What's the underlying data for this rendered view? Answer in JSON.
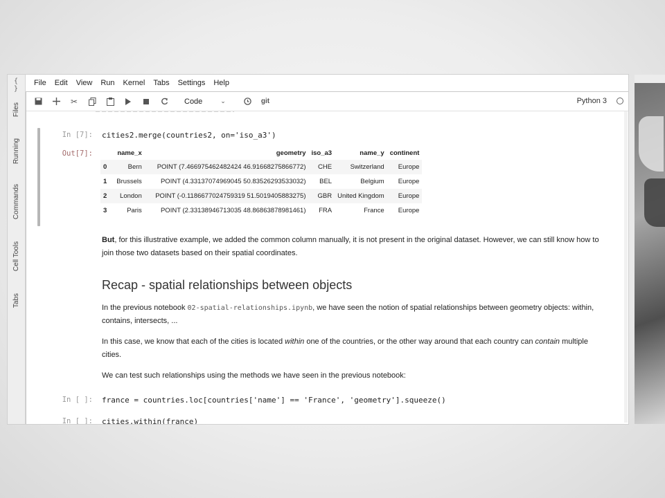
{
  "sidebar": {
    "top_mark": "{ }",
    "tabs": [
      "Files",
      "Running",
      "Commands",
      "Cell Tools",
      "Tabs"
    ]
  },
  "menubar": [
    "File",
    "Edit",
    "View",
    "Run",
    "Kernel",
    "Tabs",
    "Settings",
    "Help"
  ],
  "toolbar": {
    "icons": [
      "save-icon",
      "add-icon",
      "cut-icon",
      "copy-icon",
      "paste-icon",
      "run-icon",
      "stop-icon",
      "restart-icon"
    ],
    "cell_type": "Code",
    "git_label": "git",
    "kernel_name": "Python 3"
  },
  "cells": {
    "merge": {
      "in_prompt": "In [7]:",
      "code": "cities2.merge(countries2, on='iso_a3')",
      "out_prompt": "Out[7]:",
      "table": {
        "columns": [
          "",
          "name_x",
          "geometry",
          "iso_a3",
          "name_y",
          "continent"
        ],
        "rows": [
          [
            "0",
            "Bern",
            "POINT (7.466975462482424 46.91668275866772)",
            "CHE",
            "Switzerland",
            "Europe"
          ],
          [
            "1",
            "Brussels",
            "POINT (4.33137074969045 50.83526293533032)",
            "BEL",
            "Belgium",
            "Europe"
          ],
          [
            "2",
            "London",
            "POINT (-0.1186677024759319 51.5019405883275)",
            "GBR",
            "United Kingdom",
            "Europe"
          ],
          [
            "3",
            "Paris",
            "POINT (2.33138946713035 48.86863878981461)",
            "FRA",
            "France",
            "Europe"
          ]
        ]
      }
    },
    "md1": {
      "bold": "But",
      "text": ", for this illustrative example, we added the common column manually, it is not present in the original dataset. However, we can still know how to join those two datasets based on their spatial coordinates."
    },
    "heading": "Recap - spatial relationships between objects",
    "md2": {
      "pre": "In the previous notebook ",
      "link": "02-spatial-relationships.ipynb",
      "post": ", we have seen the notion of spatial relationships between geometry objects: within, contains, intersects, ..."
    },
    "md3": {
      "a": "In this case, we know that each of the cities is located ",
      "em1": "within",
      "b": " one of the countries, or the other way around that each country can ",
      "em2": "contain",
      "c": " multiple cities."
    },
    "md4": "We can test such relationships using the methods we have seen in the previous notebook:",
    "france": {
      "in_prompt": "In [ ]:",
      "code": "france = countries.loc[countries['name'] == 'France', 'geometry'].squeeze()"
    },
    "within": {
      "in_prompt": "In [ ]:",
      "code": "cities.within(france)"
    }
  }
}
